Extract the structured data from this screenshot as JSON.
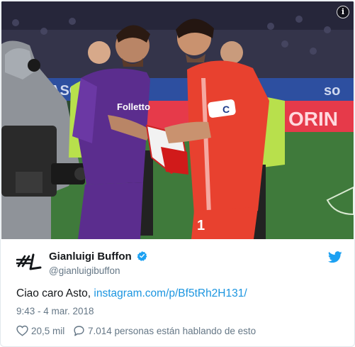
{
  "photo": {
    "alt": "",
    "banner_texts": [
      "ASO",
      "so",
      "ORIN"
    ],
    "jersey": {
      "sponsor": "Folletto",
      "captain_band": "C",
      "number": "1"
    },
    "colors": {
      "stadium_bg": "#2a2a3a",
      "pitch": "#3f7a3b",
      "fiorentina_purple": "#5b2d8e",
      "goalkeeper_red": "#e8412f",
      "referee_green": "#b8e04c"
    }
  },
  "tweet": {
    "author_name": "Gianluigi Buffon",
    "author_handle": "@gianluigibuffon",
    "logo_text": "#1",
    "text_prefix": "Ciao caro Asto, ",
    "link_text": "instagram.com/p/Bf5tRh2H131/",
    "timestamp": "9:43 - 4 mar. 2018",
    "likes": "20,5 mil",
    "talking": "7.014 personas están hablando de esto"
  },
  "icons": {
    "info": "info-icon",
    "verified": "verified-badge-icon",
    "bird": "twitter-bird-icon",
    "like": "heart-icon",
    "reply": "speech-bubble-icon"
  },
  "accent_colors": {
    "twitter_blue": "#1da1f2",
    "link_blue": "#1b95e0",
    "text": "#14171a",
    "muted": "#657786"
  }
}
